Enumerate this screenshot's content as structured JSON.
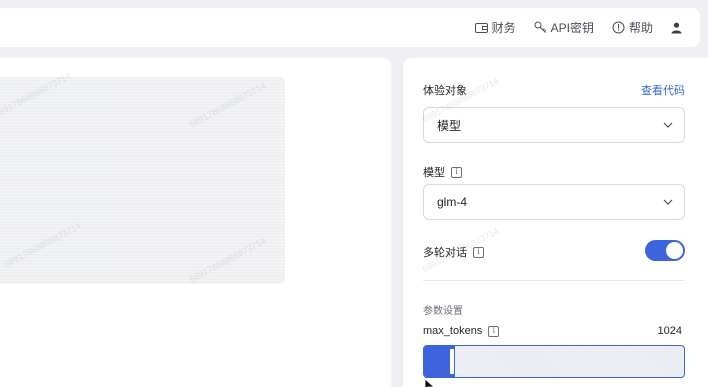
{
  "header": {
    "nav": [
      {
        "label": "财务",
        "icon": "wallet-icon"
      },
      {
        "label": "API密钥",
        "icon": "key-icon"
      },
      {
        "label": "帮助",
        "icon": "help-icon"
      },
      {
        "label": "",
        "icon": "user-icon"
      }
    ]
  },
  "config": {
    "target_label": "体验对象",
    "view_code_link": "查看代码",
    "target_value": "模型",
    "model_label": "模型",
    "model_value": "glm-4",
    "multi_turn_label": "多轮对话",
    "multi_turn_enabled": true,
    "params_title": "参数设置",
    "max_tokens_label": "max_tokens",
    "max_tokens_value": "1024",
    "max_tokens_fill_fraction": 0.12
  },
  "watermark_text": "68917868866873714",
  "colors": {
    "accent": "#3d63dd",
    "link": "#3a66d6"
  }
}
